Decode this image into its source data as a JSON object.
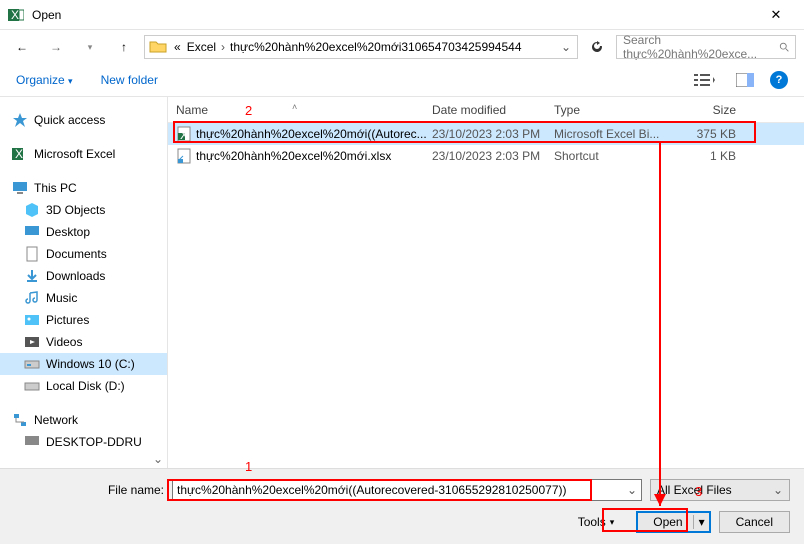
{
  "window": {
    "title": "Open",
    "close_glyph": "✕"
  },
  "nav": {
    "back": "←",
    "forward": "→",
    "up": "↑"
  },
  "breadcrumb": {
    "root_sep": "«",
    "items": [
      "Excel",
      "thực%20hành%20excel%20mới310654703425994544"
    ]
  },
  "search": {
    "placeholder": "Search thực%20hành%20exce..."
  },
  "toolbar": {
    "organize": "Organize",
    "newfolder": "New folder"
  },
  "sidebar": {
    "quick": "Quick access",
    "excel": "Microsoft Excel",
    "thispc": "This PC",
    "items": [
      "3D Objects",
      "Desktop",
      "Documents",
      "Downloads",
      "Music",
      "Pictures",
      "Videos",
      "Windows 10 (C:)",
      "Local Disk (D:)"
    ],
    "network": "Network",
    "network_items": [
      "DESKTOP-DDRU"
    ]
  },
  "columns": {
    "name": "Name",
    "date": "Date modified",
    "type": "Type",
    "size": "Size"
  },
  "files": [
    {
      "name": "thực%20hành%20excel%20mới((Autorec...",
      "date": "23/10/2023 2:03 PM",
      "type": "Microsoft Excel Bi...",
      "size": "375 KB",
      "selected": true,
      "icon": "excel"
    },
    {
      "name": "thực%20hành%20excel%20mới.xlsx",
      "date": "23/10/2023 2:03 PM",
      "type": "Shortcut",
      "size": "1 KB",
      "selected": false,
      "icon": "shortcut"
    }
  ],
  "footer": {
    "filename_label": "File name:",
    "filename_value": "thực%20hành%20excel%20mới((Autorecovered-310655292810250077))",
    "filter_label": "All Excel Files",
    "tools": "Tools",
    "open": "Open",
    "cancel": "Cancel"
  },
  "annotations": {
    "l1": "1",
    "l2": "2",
    "l3": "3"
  }
}
